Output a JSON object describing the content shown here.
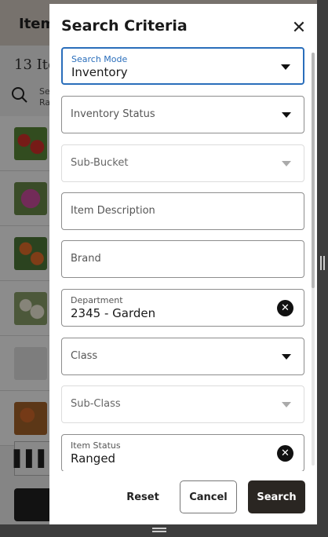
{
  "background": {
    "header_title": "Item",
    "count": "13 Ite",
    "search_label_line1": "Se",
    "search_label_line2": "Ra"
  },
  "panel": {
    "title": "Search Criteria",
    "close_icon": "close-icon"
  },
  "fields": [
    {
      "label": "Search Mode",
      "value": "Inventory",
      "type": "select",
      "state": "focused"
    },
    {
      "label": "Inventory Status",
      "value": "",
      "type": "select",
      "state": "normal"
    },
    {
      "label": "Sub-Bucket",
      "value": "",
      "type": "select",
      "state": "disabled"
    },
    {
      "label": "Item Description",
      "value": "",
      "type": "text",
      "state": "normal"
    },
    {
      "label": "Brand",
      "value": "",
      "type": "text",
      "state": "normal"
    },
    {
      "label": "Department",
      "value": "2345 - Garden",
      "type": "clearable",
      "state": "normal"
    },
    {
      "label": "Class",
      "value": "",
      "type": "select",
      "state": "normal"
    },
    {
      "label": "Sub-Class",
      "value": "",
      "type": "select",
      "state": "disabled"
    },
    {
      "label": "Item Status",
      "value": "Ranged",
      "type": "clearable",
      "state": "normal"
    }
  ],
  "footer": {
    "reset_label": "Reset",
    "cancel_label": "Cancel",
    "search_label": "Search"
  },
  "colors": {
    "accent": "#2a6ebb",
    "primary_button": "#2a2622"
  }
}
